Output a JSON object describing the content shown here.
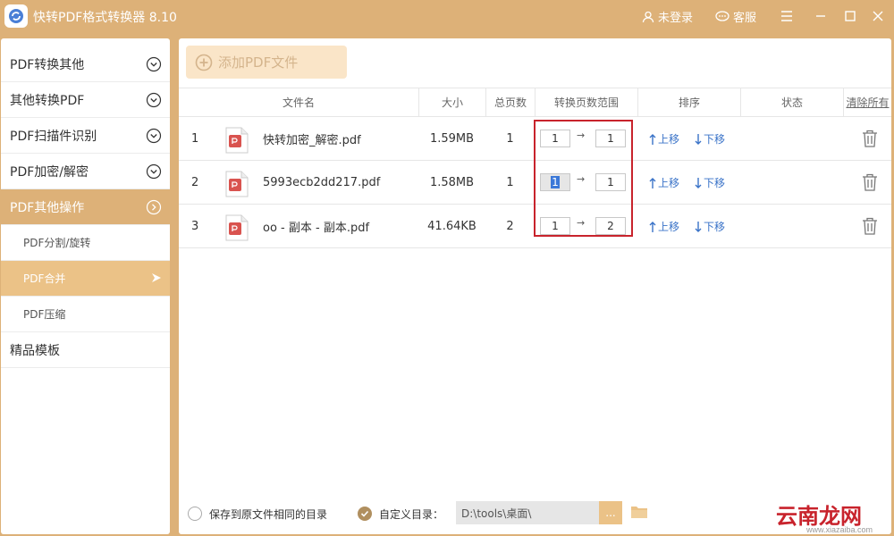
{
  "app": {
    "title": "快转PDF格式转换器 8.10"
  },
  "titlebar": {
    "login": "未登录",
    "service": "客服"
  },
  "sidebar": {
    "items": [
      {
        "label": "PDF转换其他"
      },
      {
        "label": "其他转换PDF"
      },
      {
        "label": "PDF扫描件识别"
      },
      {
        "label": "PDF加密/解密"
      },
      {
        "label": "PDF其他操作"
      }
    ],
    "sub_items": [
      {
        "label": "PDF分割/旋转"
      },
      {
        "label": "PDF合并"
      },
      {
        "label": "PDF压缩"
      }
    ],
    "templates": "精品模板"
  },
  "toolbar": {
    "add_label": "添加PDF文件"
  },
  "table": {
    "headers": {
      "filename": "文件名",
      "size": "大小",
      "pages": "总页数",
      "range": "转换页数范围",
      "order": "排序",
      "status": "状态",
      "clear": "清除所有"
    },
    "move_up": "上移",
    "move_down": "下移",
    "range_sep": "→",
    "rows": [
      {
        "index": "1",
        "name": "快转加密_解密.pdf",
        "size": "1.59MB",
        "pages": "1",
        "from": "1",
        "to": "1"
      },
      {
        "index": "2",
        "name": "5993ecb2dd217.pdf",
        "size": "1.58MB",
        "pages": "1",
        "from": "1",
        "to": "1"
      },
      {
        "index": "3",
        "name": "oo - 副本 - 副本.pdf",
        "size": "41.64KB",
        "pages": "2",
        "from": "1",
        "to": "2"
      }
    ]
  },
  "footer": {
    "same_dir_label": "保存到原文件相同的目录",
    "custom_dir_label": "自定义目录：",
    "dir_value": "D:\\tools\\桌面\\",
    "browse_label": "..."
  },
  "watermark": {
    "text": "云南龙网",
    "url": "www.xiazaiba.com"
  },
  "colors": {
    "accent": "#ddb178",
    "accent_light": "#ebc287",
    "link": "#3a73c8",
    "highlight": "#c8232c",
    "pdf_icon": "#d9534f"
  }
}
